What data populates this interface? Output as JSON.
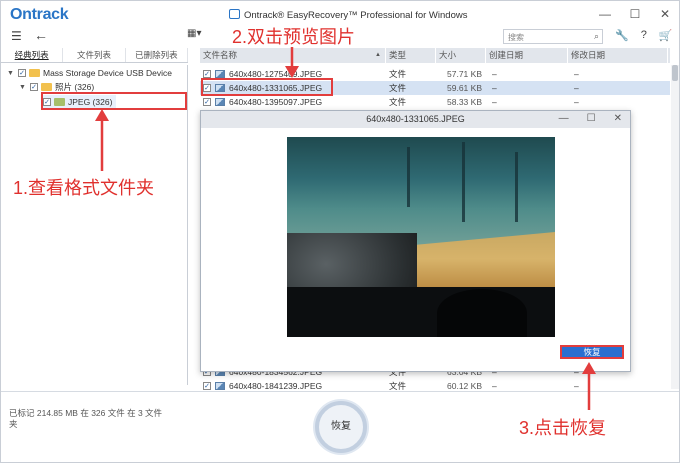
{
  "app": {
    "logo": "Ontrack",
    "title": "Ontrack® EasyRecovery™ Professional for Windows"
  },
  "window_controls": {
    "minimize": "—",
    "maximize": "☐",
    "close": "✕"
  },
  "toolbar": {
    "search_placeholder": "搜索",
    "icons": [
      "hamburger-menu-icon",
      "back-arrow-icon",
      "view-grid-icon",
      "search-icon",
      "wrench-icon",
      "help-icon",
      "cart-icon"
    ]
  },
  "left_tabs": [
    "经典列表",
    "文件列表",
    "已删除列表"
  ],
  "tree": {
    "root": "Mass Storage Device USB Device",
    "child": "照片 (326)",
    "grandchild": "JPEG (326)"
  },
  "file_table": {
    "columns": [
      "文件名称",
      "类型",
      "大小",
      "创建日期",
      "修改日期"
    ],
    "rows": [
      {
        "name": "640x480-1275409.JPEG",
        "type": "文件",
        "size": "57.71 KB",
        "created": "–",
        "modified": "–"
      },
      {
        "name": "640x480-1331065.JPEG",
        "type": "文件",
        "size": "59.61 KB",
        "created": "–",
        "modified": "–"
      },
      {
        "name": "640x480-1395097.JPEG",
        "type": "文件",
        "size": "58.33 KB",
        "created": "–",
        "modified": "–"
      },
      {
        "name": "640x480-1834562.JPEG",
        "type": "文件",
        "size": "63.04 KB",
        "created": "–",
        "modified": "–"
      },
      {
        "name": "640x480-1841239.JPEG",
        "type": "文件",
        "size": "60.12 KB",
        "created": "–",
        "modified": "–"
      }
    ]
  },
  "preview": {
    "title": "640x480-1331065.JPEG",
    "restore_label": "恢复"
  },
  "bottom": {
    "status": "已标记 214.85 MB 在 326 文件 在 3 文件夹",
    "restore_label": "恢复"
  },
  "annotations": {
    "step1": "1.查看格式文件夹",
    "step2": "2.双击预览图片",
    "step3": "3.点击恢复"
  },
  "colors": {
    "accent": "#2a6fd0",
    "annotation": "#e0312e",
    "highlight_row": "#d5e2f3"
  }
}
